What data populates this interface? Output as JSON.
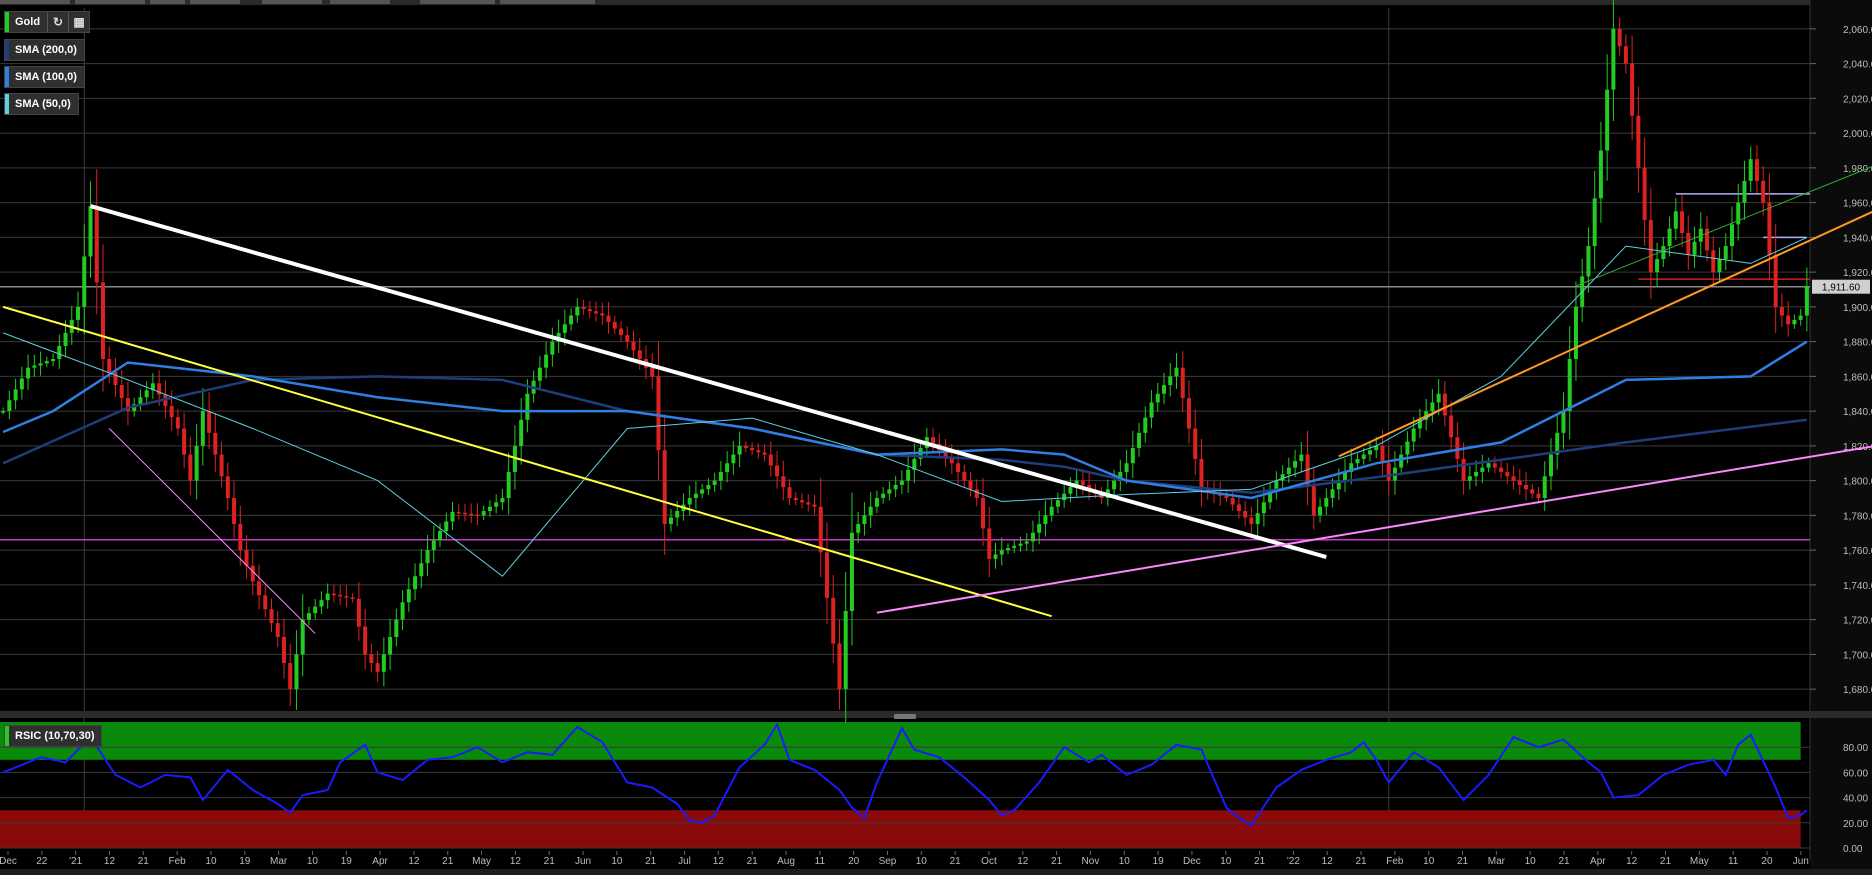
{
  "instrument": "Gold",
  "last_price_label": "1,911.60",
  "indicators": [
    {
      "label": "SMA (200,0)",
      "color": "#1f3d7a"
    },
    {
      "label": "SMA (100,0)",
      "color": "#2f7fe0"
    },
    {
      "label": "SMA (50,0)",
      "color": "#5fd0e0"
    }
  ],
  "rsi_label": "RSIC (10,70,30)",
  "icons": [
    "refresh-icon",
    "calendar-icon"
  ],
  "colors": {
    "up": "#22cc22",
    "down": "#dd2222",
    "rsi_line": "#1a1aff",
    "overbought": "#0a8a0a",
    "oversold": "#8a0a0a"
  },
  "chart_data": [
    {
      "type": "candlestick",
      "title": "Gold",
      "y_ticks": [
        "2,060.00",
        "2,040.00",
        "2,020.00",
        "2,000.00",
        "1,980.00",
        "1,960.00",
        "1,940.00",
        "1,920.00",
        "1,900.00",
        "1,880.00",
        "1,860.00",
        "1,840.00",
        "1,820.00",
        "1,800.00",
        "1,780.00",
        "1,760.00",
        "1,740.00",
        "1,720.00",
        "1,700.00",
        "1,680.00"
      ],
      "ylim": [
        1668,
        2072
      ],
      "x_ticks": [
        "Dec",
        "22",
        "'21",
        "12",
        "21",
        "Feb",
        "10",
        "19",
        "Mar",
        "10",
        "19",
        "Apr",
        "12",
        "21",
        "May",
        "12",
        "21",
        "Jun",
        "10",
        "21",
        "Jul",
        "12",
        "21",
        "Aug",
        "11",
        "20",
        "Sep",
        "10",
        "21",
        "Oct",
        "12",
        "21",
        "Nov",
        "10",
        "19",
        "Dec",
        "10",
        "21",
        "'22",
        "12",
        "21",
        "Feb",
        "10",
        "21",
        "Mar",
        "10",
        "21",
        "Apr",
        "12",
        "21",
        "May",
        "11",
        "20",
        "Jun"
      ],
      "close_path": [
        [
          0,
          1840
        ],
        [
          4,
          1865
        ],
        [
          8,
          1870
        ],
        [
          12,
          1900
        ],
        [
          14,
          1958
        ],
        [
          16,
          1870
        ],
        [
          20,
          1840
        ],
        [
          24,
          1856
        ],
        [
          28,
          1830
        ],
        [
          30,
          1800
        ],
        [
          32,
          1840
        ],
        [
          36,
          1790
        ],
        [
          38,
          1760
        ],
        [
          40,
          1742
        ],
        [
          44,
          1710
        ],
        [
          46,
          1680
        ],
        [
          48,
          1720
        ],
        [
          52,
          1735
        ],
        [
          56,
          1732
        ],
        [
          58,
          1700
        ],
        [
          60,
          1690
        ],
        [
          64,
          1730
        ],
        [
          68,
          1760
        ],
        [
          72,
          1782
        ],
        [
          76,
          1780
        ],
        [
          80,
          1790
        ],
        [
          84,
          1850
        ],
        [
          88,
          1880
        ],
        [
          92,
          1900
        ],
        [
          96,
          1895
        ],
        [
          100,
          1880
        ],
        [
          104,
          1860
        ],
        [
          106,
          1775
        ],
        [
          110,
          1790
        ],
        [
          114,
          1800
        ],
        [
          118,
          1820
        ],
        [
          122,
          1815
        ],
        [
          126,
          1790
        ],
        [
          130,
          1785
        ],
        [
          134,
          1680
        ],
        [
          136,
          1770
        ],
        [
          140,
          1790
        ],
        [
          144,
          1800
        ],
        [
          148,
          1825
        ],
        [
          152,
          1810
        ],
        [
          156,
          1790
        ],
        [
          158,
          1755
        ],
        [
          160,
          1760
        ],
        [
          164,
          1765
        ],
        [
          168,
          1785
        ],
        [
          172,
          1800
        ],
        [
          176,
          1790
        ],
        [
          180,
          1810
        ],
        [
          184,
          1845
        ],
        [
          188,
          1865
        ],
        [
          190,
          1830
        ],
        [
          192,
          1795
        ],
        [
          196,
          1790
        ],
        [
          200,
          1775
        ],
        [
          204,
          1800
        ],
        [
          208,
          1815
        ],
        [
          210,
          1780
        ],
        [
          212,
          1790
        ],
        [
          216,
          1810
        ],
        [
          220,
          1820
        ],
        [
          222,
          1800
        ],
        [
          226,
          1830
        ],
        [
          230,
          1850
        ],
        [
          234,
          1800
        ],
        [
          238,
          1810
        ],
        [
          242,
          1800
        ],
        [
          246,
          1790
        ],
        [
          250,
          1840
        ],
        [
          252,
          1900
        ],
        [
          254,
          1935
        ],
        [
          256,
          1990
        ],
        [
          258,
          2060
        ],
        [
          260,
          2040
        ],
        [
          262,
          1980
        ],
        [
          264,
          1920
        ],
        [
          266,
          1935
        ],
        [
          268,
          1955
        ],
        [
          270,
          1930
        ],
        [
          272,
          1945
        ],
        [
          274,
          1920
        ],
        [
          276,
          1935
        ],
        [
          278,
          1960
        ],
        [
          280,
          1985
        ],
        [
          282,
          1960
        ],
        [
          284,
          1900
        ],
        [
          286,
          1890
        ],
        [
          288,
          1895
        ],
        [
          289,
          1912
        ]
      ],
      "sma_200": [
        [
          0,
          1810
        ],
        [
          20,
          1842
        ],
        [
          40,
          1858
        ],
        [
          60,
          1860
        ],
        [
          80,
          1858
        ],
        [
          100,
          1840
        ],
        [
          120,
          1830
        ],
        [
          140,
          1815
        ],
        [
          160,
          1812
        ],
        [
          170,
          1808
        ],
        [
          180,
          1800
        ],
        [
          200,
          1793
        ],
        [
          220,
          1802
        ],
        [
          240,
          1812
        ],
        [
          260,
          1822
        ],
        [
          280,
          1831
        ],
        [
          289,
          1835
        ]
      ],
      "sma_100": [
        [
          0,
          1828
        ],
        [
          8,
          1840
        ],
        [
          20,
          1868
        ],
        [
          40,
          1860
        ],
        [
          60,
          1848
        ],
        [
          80,
          1840
        ],
        [
          100,
          1840
        ],
        [
          120,
          1830
        ],
        [
          140,
          1815
        ],
        [
          160,
          1818
        ],
        [
          170,
          1815
        ],
        [
          180,
          1800
        ],
        [
          200,
          1790
        ],
        [
          220,
          1810
        ],
        [
          240,
          1822
        ],
        [
          260,
          1858
        ],
        [
          280,
          1860
        ],
        [
          289,
          1880
        ]
      ],
      "sma_50": [
        [
          0,
          1885
        ],
        [
          20,
          1858
        ],
        [
          40,
          1830
        ],
        [
          60,
          1800
        ],
        [
          80,
          1745
        ],
        [
          100,
          1830
        ],
        [
          120,
          1836
        ],
        [
          140,
          1815
        ],
        [
          160,
          1788
        ],
        [
          170,
          1790
        ],
        [
          180,
          1792
        ],
        [
          200,
          1795
        ],
        [
          220,
          1820
        ],
        [
          240,
          1860
        ],
        [
          260,
          1935
        ],
        [
          280,
          1925
        ],
        [
          289,
          1940
        ]
      ],
      "horizontal_lines": [
        {
          "price": 1911.6,
          "color": "#888888"
        },
        {
          "price": 1916,
          "color": "#cc2222",
          "from": 262
        },
        {
          "price": 1766,
          "color": "#cc33cc"
        },
        {
          "price": 1965,
          "color": "#b0b0ff",
          "from": 268
        },
        {
          "price": 1940,
          "color": "#b0b0ff",
          "from": 282,
          "to": 289
        }
      ],
      "trend_lines": [
        {
          "from": [
            14,
            1958
          ],
          "to": [
            212,
            1756
          ],
          "color": "#ffffff",
          "width": 4
        },
        {
          "from": [
            0,
            1900
          ],
          "to": [
            168,
            1722
          ],
          "color": "#ffff44",
          "width": 2
        },
        {
          "from": [
            140,
            1724
          ],
          "to": [
            310,
            1826
          ],
          "color": "#ff88ff",
          "width": 2
        },
        {
          "from": [
            214,
            1814
          ],
          "to": [
            310,
            1972
          ],
          "color": "#ff9922",
          "width": 2
        },
        {
          "from": [
            252,
            1912
          ],
          "to": [
            310,
            1996
          ],
          "color": "#33aa33",
          "width": 1
        },
        {
          "from": [
            17,
            1830
          ],
          "to": [
            50,
            1712
          ],
          "color": "#ff88ff",
          "width": 1
        }
      ],
      "vertical_lines": [
        13,
        222
      ]
    },
    {
      "type": "line",
      "title": "RSIC (10,70,30)",
      "y_ticks": [
        "80.00",
        "60.00",
        "40.00",
        "20.00",
        "0.00"
      ],
      "ylim": [
        0,
        100
      ],
      "bands": {
        "overbought": 70,
        "oversold": 30
      },
      "rsi_path": [
        [
          0,
          60
        ],
        [
          6,
          72
        ],
        [
          10,
          68
        ],
        [
          14,
          88
        ],
        [
          18,
          58
        ],
        [
          22,
          48
        ],
        [
          26,
          58
        ],
        [
          30,
          56
        ],
        [
          32,
          38
        ],
        [
          36,
          62
        ],
        [
          40,
          46
        ],
        [
          44,
          35
        ],
        [
          46,
          28
        ],
        [
          48,
          42
        ],
        [
          52,
          46
        ],
        [
          54,
          68
        ],
        [
          58,
          82
        ],
        [
          60,
          60
        ],
        [
          64,
          54
        ],
        [
          68,
          70
        ],
        [
          72,
          72
        ],
        [
          76,
          80
        ],
        [
          80,
          68
        ],
        [
          84,
          76
        ],
        [
          88,
          74
        ],
        [
          92,
          96
        ],
        [
          96,
          84
        ],
        [
          100,
          52
        ],
        [
          104,
          48
        ],
        [
          108,
          35
        ],
        [
          110,
          22
        ],
        [
          112,
          20
        ],
        [
          114,
          26
        ],
        [
          118,
          64
        ],
        [
          122,
          82
        ],
        [
          124,
          98
        ],
        [
          126,
          70
        ],
        [
          130,
          62
        ],
        [
          134,
          46
        ],
        [
          136,
          32
        ],
        [
          138,
          24
        ],
        [
          140,
          52
        ],
        [
          144,
          95
        ],
        [
          146,
          78
        ],
        [
          150,
          72
        ],
        [
          154,
          56
        ],
        [
          158,
          38
        ],
        [
          160,
          26
        ],
        [
          162,
          30
        ],
        [
          166,
          52
        ],
        [
          170,
          80
        ],
        [
          174,
          68
        ],
        [
          176,
          74
        ],
        [
          180,
          58
        ],
        [
          184,
          66
        ],
        [
          188,
          82
        ],
        [
          192,
          78
        ],
        [
          196,
          32
        ],
        [
          198,
          24
        ],
        [
          200,
          18
        ],
        [
          204,
          48
        ],
        [
          208,
          62
        ],
        [
          212,
          70
        ],
        [
          216,
          76
        ],
        [
          218,
          84
        ],
        [
          220,
          70
        ],
        [
          222,
          52
        ],
        [
          226,
          76
        ],
        [
          230,
          64
        ],
        [
          234,
          38
        ],
        [
          238,
          58
        ],
        [
          242,
          88
        ],
        [
          246,
          80
        ],
        [
          250,
          86
        ],
        [
          254,
          68
        ],
        [
          256,
          60
        ],
        [
          258,
          40
        ],
        [
          262,
          42
        ],
        [
          266,
          58
        ],
        [
          270,
          66
        ],
        [
          274,
          70
        ],
        [
          276,
          58
        ],
        [
          278,
          82
        ],
        [
          280,
          90
        ],
        [
          284,
          48
        ],
        [
          286,
          24
        ],
        [
          288,
          26
        ],
        [
          289,
          30
        ]
      ]
    }
  ]
}
